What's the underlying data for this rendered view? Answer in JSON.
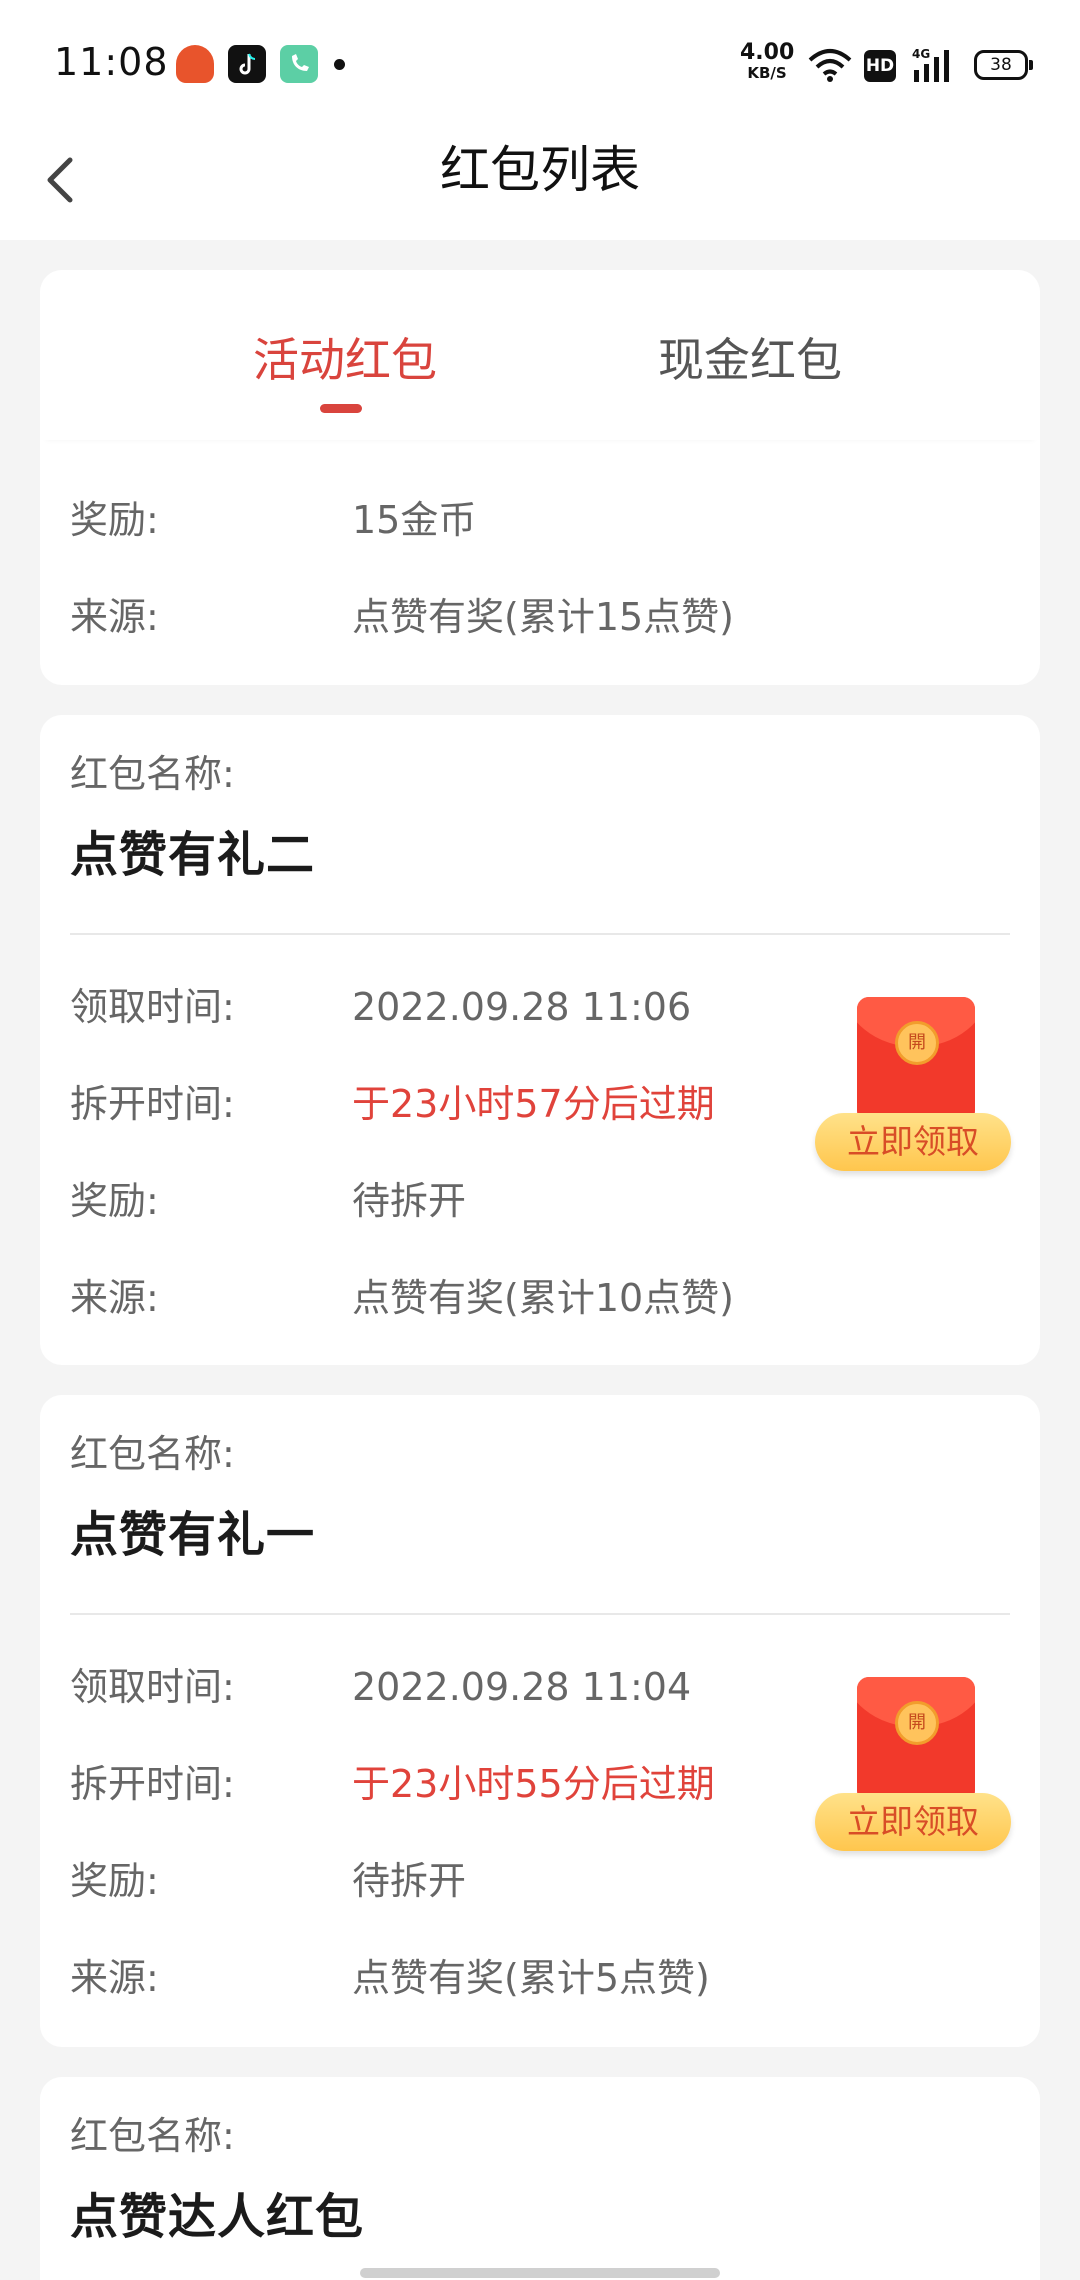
{
  "status_bar": {
    "time": "11:08",
    "net_speed_value": "4.00",
    "net_speed_unit": "KB/S",
    "hd_label": "HD",
    "signal_label": "4G",
    "battery": "38"
  },
  "nav": {
    "title": "红包列表"
  },
  "tabs": [
    {
      "label": "活动红包",
      "active": true
    },
    {
      "label": "现金红包",
      "active": false
    }
  ],
  "accent_color": "#d9443d",
  "partial_card": {
    "reward_label": "奖励:",
    "reward_value": "15金币",
    "source_label": "来源:",
    "source_value": "点赞有奖(累计15点赞)"
  },
  "cards": [
    {
      "name_label": "红包名称:",
      "name": "点赞有礼二",
      "receive_label": "领取时间:",
      "receive_time": "2022.09.28 11:06",
      "open_label": "拆开时间:",
      "open_value": "于23小时57分后过期",
      "reward_label": "奖励:",
      "reward_value": "待拆开",
      "source_label": "来源:",
      "source_value": "点赞有奖(累计10点赞)",
      "seal_text": "開",
      "claim_label": "立即领取"
    },
    {
      "name_label": "红包名称:",
      "name": "点赞有礼一",
      "receive_label": "领取时间:",
      "receive_time": "2022.09.28 11:04",
      "open_label": "拆开时间:",
      "open_value": "于23小时55分后过期",
      "reward_label": "奖励:",
      "reward_value": "待拆开",
      "source_label": "来源:",
      "source_value": "点赞有奖(累计5点赞)",
      "seal_text": "開",
      "claim_label": "立即领取"
    },
    {
      "name_label": "红包名称:",
      "name": "点赞达人红包"
    }
  ]
}
